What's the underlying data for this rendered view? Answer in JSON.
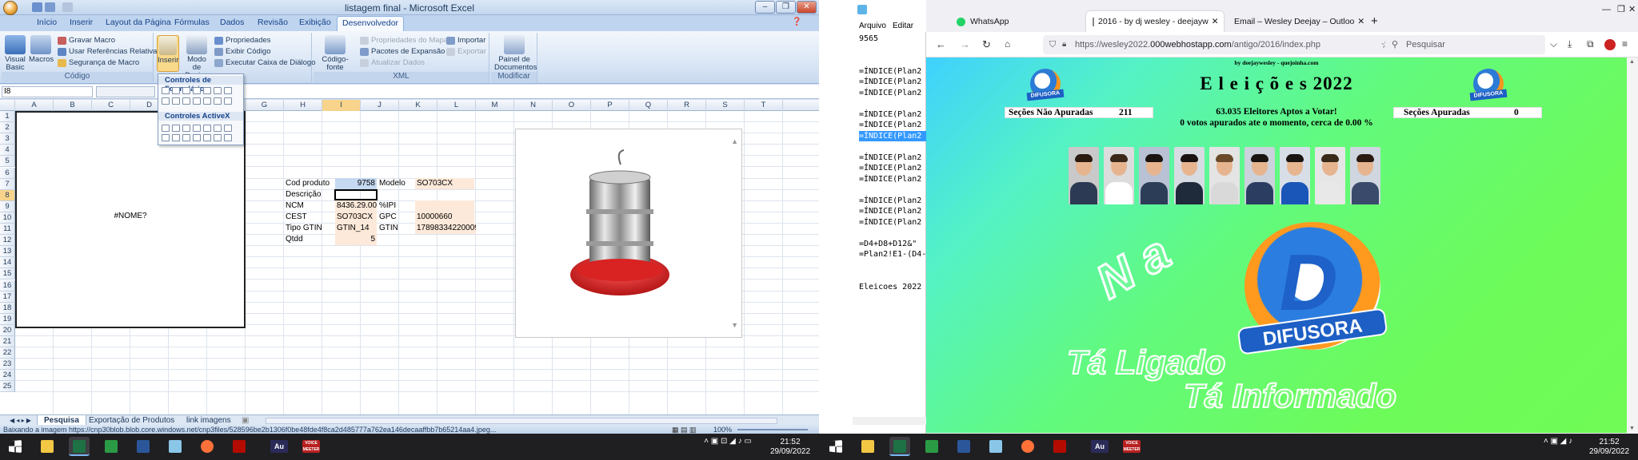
{
  "excel": {
    "window_title": "listagem final - Microsoft Excel",
    "tabs": [
      "Início",
      "Inserir",
      "Layout da Página",
      "Fórmulas",
      "Dados",
      "Revisão",
      "Exibição",
      "Desenvolvedor"
    ],
    "active_tab": "Desenvolvedor",
    "ribbon": {
      "visual_basic": "Visual Basic",
      "macros": "Macros",
      "gravar_macro": "Gravar Macro",
      "usar_ref": "Usar Referências Relativas",
      "seguranca": "Segurança de Macro",
      "codigo_group": "Código",
      "inserir": "Inserir",
      "modo_design": "Modo de Design",
      "propriedades": "Propriedades",
      "exibir_codigo": "Exibir Código",
      "executar": "Executar Caixa de Diálogo",
      "codigo_fonte": "Código-fonte",
      "prop_mapa": "Propriedades do Mapa",
      "pacotes": "Pacotes de Expansão",
      "atualizar": "Atualizar Dados",
      "importar": "Importar",
      "exportar": "Exportar",
      "xml_group": "XML",
      "painel": "Painel de Documentos",
      "modificar_group": "Modificar"
    },
    "popup": {
      "form_controls": "Controles de Formulário",
      "activex": "Controles ActiveX"
    },
    "name_box": "I8",
    "columns": [
      "A",
      "B",
      "C",
      "D",
      "E",
      "F",
      "G",
      "H",
      "I",
      "J",
      "K",
      "L",
      "M",
      "N",
      "O",
      "P",
      "Q",
      "R",
      "S",
      "T"
    ],
    "rows": [
      "1",
      "2",
      "3",
      "4",
      "5",
      "6",
      "7",
      "8",
      "9",
      "10",
      "11",
      "12",
      "13",
      "14",
      "15",
      "16",
      "17",
      "18",
      "19",
      "20",
      "21",
      "22",
      "23",
      "24",
      "25"
    ],
    "image_error": "#NOME?",
    "cells": {
      "cod_produto_label": "Cod produto",
      "cod_produto": "9758",
      "modelo_label": "Modelo",
      "modelo": "SO703CX",
      "descricao_label": "Descrição",
      "ncm_label": "NCM",
      "ncm": "8436.29.00",
      "ipi_label": "%IPI",
      "cest_label": "CEST",
      "cest": "SO703CX",
      "gpc_label": "GPC",
      "gpc": "10000660",
      "tipo_gtin_label": "Tipo GTIN",
      "tipo_gtin": "GTIN_14",
      "gtin_label": "GTIN",
      "gtin": "17898334220009",
      "qtdd_label": "Qtdd",
      "qtdd": "5"
    },
    "sheet_tabs": [
      "Pesquisa",
      "Exportação de Produtos",
      "link imagens"
    ],
    "status": "Baixando a imagem https://cnp30blob.blob.core.windows.net/cnp3files/528596be2b1306f0be48fde4f8ca2d485777a762ea146decaaffbb7b65214aa4.jpeg...",
    "zoom": "100%"
  },
  "notepad": {
    "menu": [
      "Arquivo",
      "Editar"
    ],
    "lines": [
      "9565",
      "",
      "",
      "=ÍNDICE(Plan2",
      "=ÍNDICE(Plan2",
      "=ÍNDICE(Plan2",
      "",
      "=ÍNDICE(Plan2",
      "=ÍNDICE(Plan2",
      "=ÍNDICE(Plan2",
      "",
      "=ÍNDICE(Plan2",
      "=ÍNDICE(Plan2",
      "=ÍNDICE(Plan2",
      "",
      "=ÍNDICE(Plan2",
      "=ÍNDICE(Plan2",
      "=ÍNDICE(Plan2",
      "",
      "=D4+D8+D12&\"",
      "=Plan2!E1-(D4-",
      "",
      "",
      "Eleicoes 2022"
    ],
    "highlight_line": 9
  },
  "firefox": {
    "tabs": [
      {
        "label": "WhatsApp"
      },
      {
        "label": "2016 - by dj wesley - deejayw"
      },
      {
        "label": "Email – Wesley Deejay – Outloo"
      }
    ],
    "url_prefix": "https://wesley2022.",
    "url_domain": "000webhostapp.com",
    "url_path": "/antigo/2016/index.php",
    "search_placeholder": "Pesquisar",
    "page": {
      "byline": "by deejaywesley - quejoinha.com",
      "title": "E l e i ç õ e s 2022",
      "secoes_nao_label": "Seções Não Apuradas",
      "secoes_nao_value": "211",
      "eleitores": "63.035 Eleitores Aptos a Votar!",
      "votos": "0 votos apurados ate o momento, cerca de 0.00 %",
      "secoes_label": "Seções Apuradas",
      "secoes_value": "0",
      "logo_text": "DIFUSORA",
      "slogan_na": "N a",
      "slogan_1": "Tá Ligado",
      "slogan_2": "Tá Informado"
    }
  },
  "taskbar": {
    "time": "21:52",
    "date": "29/09/2022",
    "time2": "21:52",
    "date2": "29/09/2022",
    "au": "Au",
    "voice": "VOICE MEETER"
  }
}
